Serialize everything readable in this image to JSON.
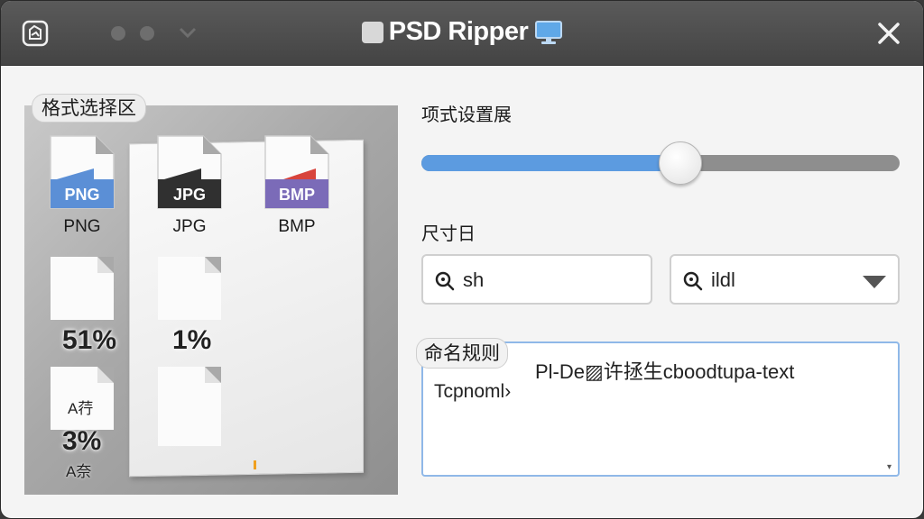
{
  "window": {
    "title": "PSD Ripper",
    "controls": [
      "minimize-dot",
      "zoom-dot",
      "chevron-down"
    ]
  },
  "left_panel": {
    "section_label": "格式选择区",
    "formats": [
      {
        "badge": "PNG",
        "label": "PNG",
        "color": "#5b8fd6"
      },
      {
        "badge": "JPG",
        "label": "JPG",
        "color": "#303030"
      },
      {
        "badge": "BMP",
        "label": "BMP",
        "color": "#7b6bb8"
      }
    ],
    "placeholders": [
      {
        "percent": "51%"
      },
      {
        "percent": "1%"
      },
      {
        "percent": "3%",
        "top_text": "A荇",
        "bottom_text": "A‌‌奈"
      }
    ]
  },
  "right_panel": {
    "slider_label": "项式设置展",
    "slider_value": 0.55,
    "size_label": "尺寸日",
    "search_left": {
      "value": "sh",
      "icon": "search-icon"
    },
    "search_right": {
      "value": "ildl",
      "icon": "search-icon"
    },
    "naming_label": "命名规则",
    "naming_text_line1": "Pl-De▨许拯生cboodtupa-text",
    "naming_text_line2": "Tcpnoml›"
  },
  "colors": {
    "titlebar": "#4a4a4a",
    "accent": "#5c9be0",
    "bmp": "#7b6bb8",
    "png": "#5b8fd6"
  }
}
